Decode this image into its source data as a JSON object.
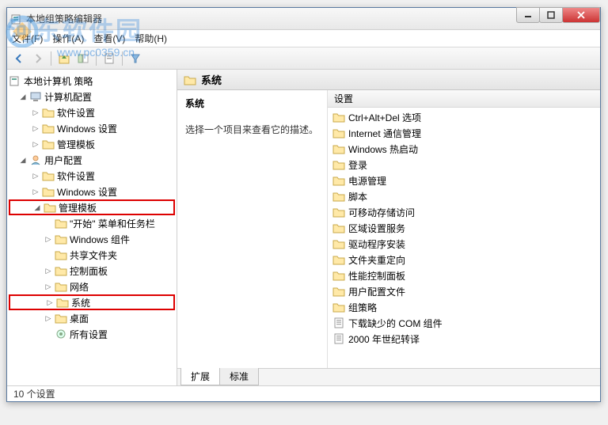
{
  "window": {
    "title": "本地组策略编辑器"
  },
  "menu": {
    "file": "文件(F)",
    "action": "操作(A)",
    "view": "查看(V)",
    "help": "帮助(H)"
  },
  "tree": {
    "root": "本地计算机 策略",
    "computer_config": "计算机配置",
    "cc_software": "软件设置",
    "cc_windows": "Windows 设置",
    "cc_templates": "管理模板",
    "user_config": "用户配置",
    "uc_software": "软件设置",
    "uc_windows": "Windows 设置",
    "uc_templates": "管理模板",
    "start_taskbar": "\"开始\" 菜单和任务栏",
    "win_components": "Windows 组件",
    "shared_folders": "共享文件夹",
    "control_panel": "控制面板",
    "network": "网络",
    "system": "系统",
    "desktop": "桌面",
    "all_settings": "所有设置"
  },
  "main": {
    "header": "系统",
    "desc_prompt": "选择一个项目来查看它的描述。",
    "col_setting": "设置",
    "items": [
      {
        "icon": "folder",
        "label": "Ctrl+Alt+Del 选项"
      },
      {
        "icon": "folder",
        "label": "Internet 通信管理"
      },
      {
        "icon": "folder",
        "label": "Windows 热启动"
      },
      {
        "icon": "folder",
        "label": "登录"
      },
      {
        "icon": "folder",
        "label": "电源管理"
      },
      {
        "icon": "folder",
        "label": "脚本"
      },
      {
        "icon": "folder",
        "label": "可移动存储访问"
      },
      {
        "icon": "folder",
        "label": "区域设置服务"
      },
      {
        "icon": "folder",
        "label": "驱动程序安装"
      },
      {
        "icon": "folder",
        "label": "文件夹重定向"
      },
      {
        "icon": "folder",
        "label": "性能控制面板"
      },
      {
        "icon": "folder",
        "label": "用户配置文件"
      },
      {
        "icon": "folder",
        "label": "组策略"
      },
      {
        "icon": "setting",
        "label": "下载缺少的 COM 组件"
      },
      {
        "icon": "setting",
        "label": "2000 年世纪转译"
      }
    ]
  },
  "tabs": {
    "extended": "扩展",
    "standard": "标准"
  },
  "status": "10 个设置",
  "watermark": {
    "text": "河东软件园",
    "url": "www.pc0359.cn"
  }
}
